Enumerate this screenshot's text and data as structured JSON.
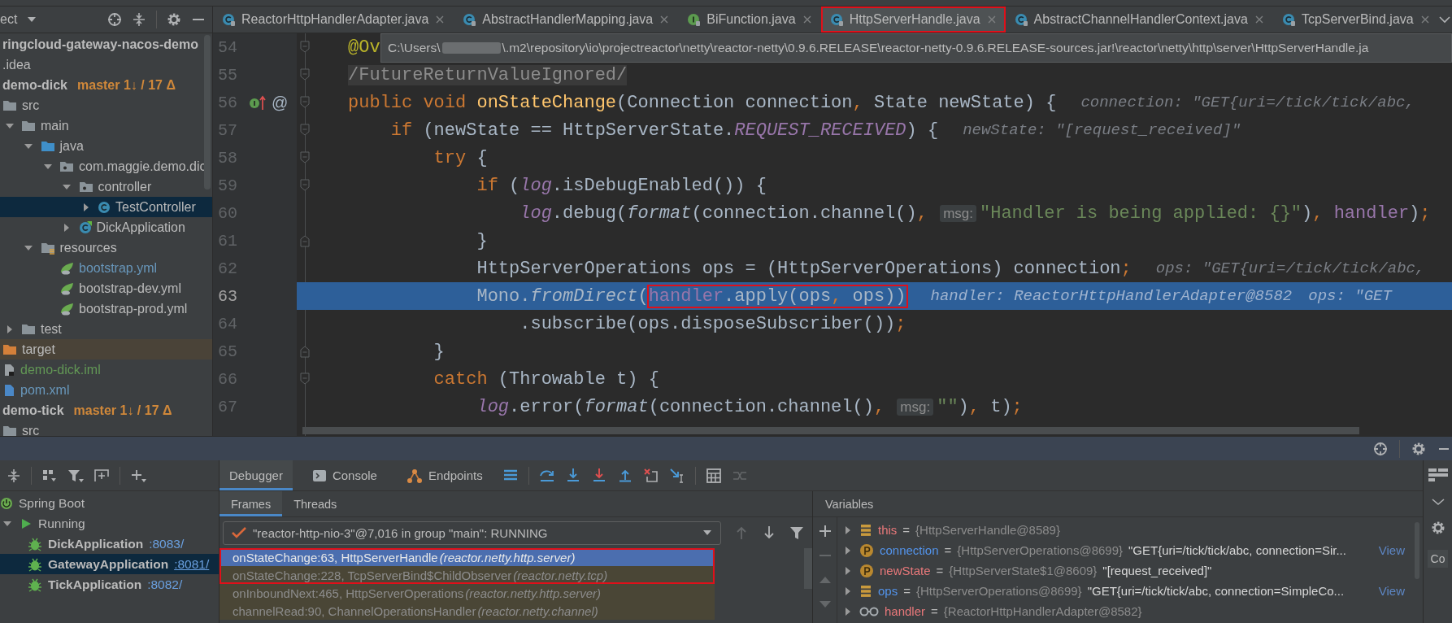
{
  "project_panel": {
    "title": "ect",
    "tree": [
      {
        "name": "ringcloud-gateway-nacos-demo",
        "kind": "module",
        "selected": false,
        "children": [
          {
            "name": ".idea",
            "kind": "folder",
            "selected": false
          },
          {
            "name": "demo-dick",
            "kind": "module",
            "branch": "master 1↓ / 17 Δ",
            "selected": false,
            "children": [
              {
                "name": "src",
                "kind": "folder",
                "selected": false,
                "children": [
                  {
                    "name": "main",
                    "kind": "folder",
                    "expanded": true,
                    "selected": false,
                    "children": [
                      {
                        "name": "java",
                        "kind": "source-folder",
                        "expanded": true,
                        "selected": false,
                        "children": [
                          {
                            "name": "com.maggie.demo.dic",
                            "kind": "package",
                            "expanded": true,
                            "selected": false,
                            "children": [
                              {
                                "name": "controller",
                                "kind": "package",
                                "expanded": true,
                                "selected": false,
                                "children": [
                                  {
                                    "name": "TestController",
                                    "kind": "class",
                                    "expanded": false,
                                    "selected": true
                                  }
                                ]
                              },
                              {
                                "name": "DickApplication",
                                "kind": "boot-class",
                                "expanded": false,
                                "selected": false
                              }
                            ]
                          }
                        ]
                      },
                      {
                        "name": "resources",
                        "kind": "resource-folder",
                        "expanded": true,
                        "selected": false,
                        "children": [
                          {
                            "name": "bootstrap.yml",
                            "kind": "spring-config",
                            "color": "#6897bb",
                            "selected": false
                          },
                          {
                            "name": "bootstrap-dev.yml",
                            "kind": "spring-config",
                            "selected": false
                          },
                          {
                            "name": "bootstrap-prod.yml",
                            "kind": "spring-config",
                            "selected": false
                          }
                        ]
                      }
                    ]
                  },
                  {
                    "name": "test",
                    "kind": "folder",
                    "expanded": false,
                    "selected": false
                  }
                ]
              },
              {
                "name": "target",
                "kind": "excluded-folder",
                "excluded": true,
                "selected": false
              },
              {
                "name": "demo-dick.iml",
                "kind": "iml-file",
                "color": "#629755",
                "selected": false
              },
              {
                "name": "pom.xml",
                "kind": "maven-file",
                "color": "#6897bb",
                "selected": false
              }
            ]
          },
          {
            "name": "demo-tick",
            "kind": "module",
            "branch": "master 1↓ / 17 Δ",
            "selected": false,
            "children": [
              {
                "name": "src",
                "kind": "folder",
                "selected": false
              }
            ]
          }
        ]
      }
    ]
  },
  "editor": {
    "tabs": [
      {
        "label": "ReactorHttpHandlerAdapter.java",
        "kind": "class-locked",
        "selected": false,
        "annotated": false
      },
      {
        "label": "AbstractHandlerMapping.java",
        "kind": "class-locked",
        "selected": false,
        "annotated": false
      },
      {
        "label": "BiFunction.java",
        "kind": "interface-locked",
        "selected": false,
        "annotated": false
      },
      {
        "label": "HttpServerHandle.java",
        "kind": "class-locked",
        "selected": true,
        "annotated": true
      },
      {
        "label": "AbstractChannelHandlerContext.java",
        "kind": "class-locked",
        "selected": false,
        "annotated": false
      },
      {
        "label": "TcpServerBind.java",
        "kind": "class-locked",
        "selected": false,
        "annotated": false
      }
    ],
    "tooltip": {
      "prefix": "C:\\Users\\",
      "path": "\\.m2\\repository\\io\\projectreactor\\netty\\reactor-netty\\0.9.6.RELEASE\\reactor-netty-0.9.6.RELEASE-sources.jar!\\reactor\\netty\\http\\server\\HttpServerHandle.ja"
    },
    "lines": [
      {
        "number": "54",
        "current": false,
        "fold": {
          "kind": "start"
        },
        "tokens": [
          {
            "text": "@Ov",
            "kind": "annotation"
          }
        ]
      },
      {
        "number": "55",
        "current": false,
        "fold": {
          "kind": "start"
        },
        "tokens": [
          {
            "text": "/FutureReturnValueIgnored/",
            "kind": "folded"
          }
        ]
      },
      {
        "number": "56",
        "current": false,
        "fold": {
          "kind": "start"
        },
        "markers": [
          {
            "kind": "implemented"
          }
        ],
        "gutter_label": "@",
        "tokens": [
          {
            "text": "public void ",
            "kind": "kw"
          },
          {
            "text": "onStateChange",
            "kind": "method"
          },
          {
            "text": "(Connection connection",
            "kind": "plain"
          },
          {
            "text": ", ",
            "kind": "punct"
          },
          {
            "text": "State newState) {",
            "kind": "plain"
          }
        ],
        "hints": [
          "connection: \"GET{uri=/tick/tick/abc,"
        ]
      },
      {
        "number": "57",
        "current": false,
        "fold": {
          "kind": "start"
        },
        "tokens": [
          {
            "text": "    if ",
            "kind": "kw"
          },
          {
            "text": "(newState == HttpServerState.",
            "kind": "plain"
          },
          {
            "text": "REQUEST_RECEIVED",
            "kind": "field"
          },
          {
            "text": ") {",
            "kind": "plain"
          }
        ],
        "hints": [
          "newState: \"[request_received]\""
        ]
      },
      {
        "number": "58",
        "current": false,
        "fold": {
          "kind": "start"
        },
        "tokens": [
          {
            "text": "        try ",
            "kind": "kw"
          },
          {
            "text": "{",
            "kind": "plain"
          }
        ]
      },
      {
        "number": "59",
        "current": false,
        "fold": {
          "kind": "start"
        },
        "tokens": [
          {
            "text": "            if ",
            "kind": "kw"
          },
          {
            "text": "(",
            "kind": "plain"
          },
          {
            "text": "log",
            "kind": "field"
          },
          {
            "text": ".isDebugEnabled()) {",
            "kind": "plain"
          }
        ]
      },
      {
        "number": "60",
        "current": false,
        "tokens": [
          {
            "text": "                log",
            "kind": "field"
          },
          {
            "text": ".debug(",
            "kind": "plain"
          },
          {
            "text": "format",
            "kind": "static"
          },
          {
            "text": "(connection.channel()",
            "kind": "plain"
          },
          {
            "text": ", ",
            "kind": "punct"
          },
          {
            "text": "msg:",
            "kind": "hint"
          },
          {
            "text": "\"Handler is being applied: {}\"",
            "kind": "string"
          },
          {
            "text": ")",
            "kind": "plain"
          },
          {
            "text": ", ",
            "kind": "punct"
          },
          {
            "text": "handler",
            "kind": "member"
          },
          {
            "text": ")",
            "kind": "plain"
          },
          {
            "text": ";",
            "kind": "punct"
          }
        ]
      },
      {
        "number": "61",
        "current": false,
        "fold": {
          "kind": "end"
        },
        "tokens": [
          {
            "text": "            }",
            "kind": "plain"
          }
        ]
      },
      {
        "number": "62",
        "current": false,
        "tokens": [
          {
            "text": "            HttpServerOperations ops = (HttpServerOperations) connection",
            "kind": "plain"
          },
          {
            "text": ";",
            "kind": "punct"
          }
        ],
        "hints": [
          "ops: \"GET{uri=/tick/tick/abc,"
        ]
      },
      {
        "number": "63",
        "current": true,
        "tokens": [
          {
            "text": "            Mono.",
            "kind": "plain"
          },
          {
            "text": "fromDirect",
            "kind": "static"
          },
          {
            "text": "(",
            "kind": "plain"
          },
          {
            "kind": "group",
            "boxed": true,
            "tokens": [
              {
                "text": "handler",
                "kind": "member"
              },
              {
                "text": ".apply(ops",
                "kind": "plain"
              },
              {
                "text": ", ",
                "kind": "punct"
              },
              {
                "text": "ops))",
                "kind": "plain"
              }
            ]
          }
        ],
        "hints": [
          "handler: ReactorHttpHandlerAdapter@8582",
          "ops: \"GET"
        ]
      },
      {
        "number": "64",
        "current": false,
        "tokens": [
          {
            "text": "                .subscribe(ops.disposeSubscriber())",
            "kind": "plain"
          },
          {
            "text": ";",
            "kind": "punct"
          }
        ]
      },
      {
        "number": "65",
        "current": false,
        "fold": {
          "kind": "end"
        },
        "tokens": [
          {
            "text": "        }",
            "kind": "plain"
          }
        ]
      },
      {
        "number": "66",
        "current": false,
        "fold": {
          "kind": "start"
        },
        "tokens": [
          {
            "text": "        catch ",
            "kind": "kw"
          },
          {
            "text": "(Throwable t) {",
            "kind": "plain"
          }
        ]
      },
      {
        "number": "67",
        "current": false,
        "tokens": [
          {
            "text": "            log",
            "kind": "field"
          },
          {
            "text": ".error(",
            "kind": "plain"
          },
          {
            "text": "format",
            "kind": "static"
          },
          {
            "text": "(connection.channel()",
            "kind": "plain"
          },
          {
            "text": ", ",
            "kind": "punct"
          },
          {
            "text": "msg:",
            "kind": "hint"
          },
          {
            "text": "\"\"",
            "kind": "string"
          },
          {
            "text": ")",
            "kind": "plain"
          },
          {
            "text": ", ",
            "kind": "punct"
          },
          {
            "text": "t)",
            "kind": "plain"
          },
          {
            "text": ";",
            "kind": "punct"
          }
        ]
      }
    ]
  },
  "services_panel": {
    "tree": [
      {
        "name": "Spring Boot",
        "kind": "spring-boot",
        "selected": false,
        "children": [
          {
            "name": "Running",
            "kind": "run",
            "expanded": true,
            "selected": false,
            "children": [
              {
                "name": "DickApplication",
                "port": ":8083/",
                "kind": "bug",
                "selected": false
              },
              {
                "name": "GatewayApplication",
                "port": ":8081/",
                "kind": "bug",
                "selected": true
              },
              {
                "name": "TickApplication",
                "port": ":8082/",
                "kind": "bug",
                "selected": false
              }
            ]
          }
        ]
      }
    ]
  },
  "debugger": {
    "tabs": [
      {
        "label": "Debugger",
        "kind": "debugger",
        "selected": true
      },
      {
        "label": "Console",
        "kind": "console",
        "selected": false
      },
      {
        "label": "Endpoints",
        "kind": "endpoints",
        "selected": false
      }
    ],
    "toolbar": [
      {
        "kind": "menu",
        "disabled": false
      },
      {
        "kind": "step-over",
        "disabled": false
      },
      {
        "kind": "step-into",
        "disabled": false
      },
      {
        "kind": "force-step-into",
        "disabled": false
      },
      {
        "kind": "step-out",
        "disabled": false
      },
      {
        "kind": "drop-frame",
        "disabled": false
      },
      {
        "kind": "run-to-cursor",
        "disabled": false
      },
      {
        "kind": "evaluate",
        "disabled": false
      },
      {
        "kind": "trace",
        "disabled": true
      }
    ],
    "subtabs": [
      {
        "label": "Frames",
        "selected": true
      },
      {
        "label": "Threads",
        "selected": false
      }
    ],
    "thread": {
      "label": "\"reactor-http-nio-3\"@7,016 in group \"main\": RUNNING"
    },
    "thread_nav": [
      {
        "kind": "up",
        "disabled": true
      },
      {
        "kind": "down",
        "disabled": false
      },
      {
        "kind": "filter",
        "disabled": false
      }
    ],
    "frames": [
      {
        "method": "onStateChange:63, HttpServerHandle",
        "package": "(reactor.netty.http.server)",
        "selected": true,
        "library": false,
        "annotated": true
      },
      {
        "method": "onStateChange:228, TcpServerBind$ChildObserver",
        "package": "(reactor.netty.tcp)",
        "selected": false,
        "library": true,
        "annotated": true
      },
      {
        "method": "onInboundNext:465, HttpServerOperations",
        "package": "(reactor.netty.http.server)",
        "selected": false,
        "library": true,
        "annotated": false
      },
      {
        "method": "channelRead:90, ChannelOperationsHandler",
        "package": "(reactor.netty.channel)",
        "selected": false,
        "library": true,
        "annotated": false
      }
    ]
  },
  "variables": {
    "title": "Variables",
    "actions": [
      {
        "kind": "add",
        "disabled": false
      },
      {
        "kind": "remove",
        "disabled": true
      },
      {
        "kind": "up",
        "disabled": true
      },
      {
        "kind": "down",
        "disabled": true
      }
    ],
    "items": [
      {
        "name": "this",
        "kind": "field",
        "color": "#e8787a",
        "separator": "=",
        "type": "{HttpServerHandle@8589}",
        "expanded": false
      },
      {
        "name": "connection",
        "kind": "parameter",
        "color": "#5394ec",
        "separator": "=",
        "type": "{HttpServerOperations@8699}",
        "value": "\"GET{uri=/tick/tick/abc, connection=Sir...",
        "link": "View",
        "expanded": false
      },
      {
        "name": "newState",
        "kind": "parameter",
        "color": "#e8787a",
        "separator": "=",
        "type": "{HttpServerState$1@8609}",
        "value": "\"[request_received]\"",
        "expanded": false
      },
      {
        "name": "ops",
        "kind": "field",
        "color": "#5394ec",
        "separator": "=",
        "type": "{HttpServerOperations@8699}",
        "value": "\"GET{uri=/tick/tick/abc, connection=SimpleCo...",
        "link": "View",
        "expanded": false
      },
      {
        "name": "handler",
        "kind": "watch",
        "color": "#e8787a",
        "separator": "=",
        "type": "{ReactorHttpHandlerAdapter@8582}",
        "expanded": false
      }
    ]
  },
  "side_panel": {
    "label": "Co"
  }
}
